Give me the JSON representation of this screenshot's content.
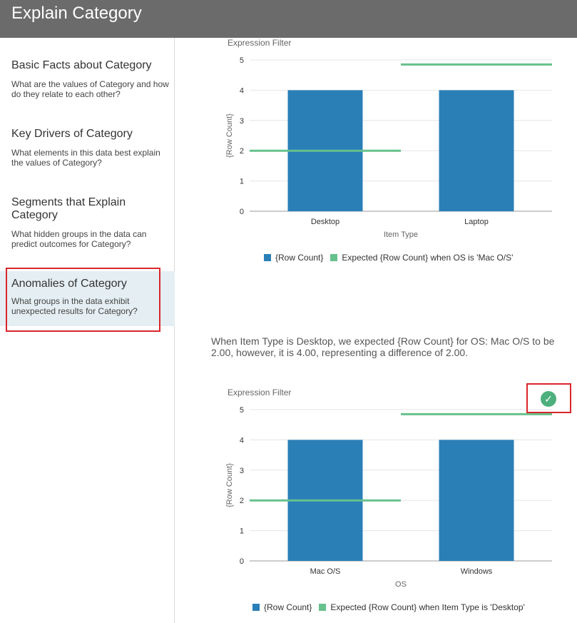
{
  "header": {
    "title": "Explain Category"
  },
  "sidebar": {
    "items": [
      {
        "title": "Basic Facts about Category",
        "desc": "What are the values of Category and how do they relate to each other?"
      },
      {
        "title": "Key Drivers of Category",
        "desc": "What elements in this data best explain the values of Category?"
      },
      {
        "title": "Segments that Explain Category",
        "desc": "What hidden groups in the data can predict outcomes for Category?"
      },
      {
        "title": "Anomalies of Category",
        "desc": "What groups in the data exhibit unexpected results for Category?"
      }
    ],
    "active_index": 3
  },
  "main": {
    "explanation": "When Item Type is Desktop, we expected {Row Count} for OS: Mac O/S to be 2.00, however, it is 4.00, representing a difference of 2.00."
  },
  "colors": {
    "bar": "#2a7fb7",
    "expected": "#66c18c",
    "accent_box": "#d9262b",
    "check": "#4caf7d"
  },
  "icons": {
    "check_button": "check-circle-icon"
  },
  "chart_data": [
    {
      "type": "bar",
      "title": "Expression Filter",
      "xlabel": "Item Type",
      "ylabel": "{Row Count}",
      "categories": [
        "Desktop",
        "Laptop"
      ],
      "ylim": [
        0,
        5
      ],
      "yticks": [
        "0",
        "1",
        "2",
        "3",
        "4",
        "5"
      ],
      "grid": true,
      "legend_position": "bottom",
      "series": [
        {
          "name": "{Row Count}",
          "kind": "bar",
          "values": [
            4,
            4
          ]
        },
        {
          "name": "Expected {Row Count} when OS is 'Mac O/S'",
          "kind": "line-segment",
          "values": [
            2.0,
            4.85
          ]
        }
      ]
    },
    {
      "type": "bar",
      "title": "Expression Filter",
      "xlabel": "OS",
      "ylabel": "{Row Count}",
      "categories": [
        "Mac O/S",
        "Windows"
      ],
      "ylim": [
        0,
        5
      ],
      "yticks": [
        "0",
        "1",
        "2",
        "3",
        "4",
        "5"
      ],
      "grid": true,
      "legend_position": "bottom",
      "series": [
        {
          "name": "{Row Count}",
          "kind": "bar",
          "values": [
            4,
            4
          ]
        },
        {
          "name": "Expected {Row Count} when Item Type is 'Desktop'",
          "kind": "line-segment",
          "values": [
            2.0,
            4.85
          ]
        }
      ]
    }
  ]
}
